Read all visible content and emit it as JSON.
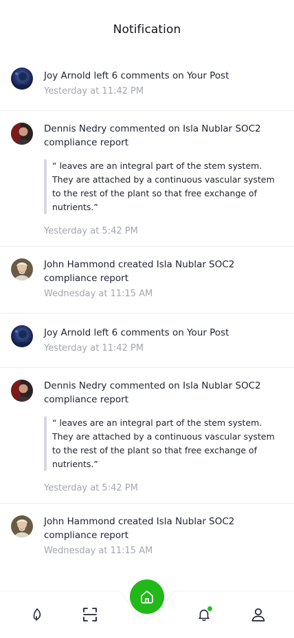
{
  "header": {
    "title": "Notification"
  },
  "notifications": [
    {
      "avatar": "joy-arnold-avatar",
      "title": "Joy Arnold left 6 comments on Your Post",
      "time": "Yesterday at 11:42 PM"
    },
    {
      "avatar": "dennis-nedry-avatar",
      "title": "Dennis Nedry commented on Isla Nublar SOC2 compliance report",
      "quote": "“ leaves are an integral part of the stem system. They are attached by a continuous vascular system to the rest of the plant so that free exchange of nutrients.”",
      "time": "Yesterday at 5:42 PM"
    },
    {
      "avatar": "john-hammond-avatar",
      "title": "John Hammond created Isla Nublar SOC2 compliance report",
      "time": "Wednesday at 11:15 AM"
    },
    {
      "avatar": "joy-arnold-avatar",
      "title": "Joy Arnold left 6 comments on Your Post",
      "time": "Yesterday at 11:42 PM"
    },
    {
      "avatar": "dennis-nedry-avatar",
      "title": "Dennis Nedry commented on Isla Nublar SOC2 compliance report",
      "quote": "“ leaves are an integral part of the stem system. They are attached by a continuous vascular system to the rest of the plant so that free exchange of nutrients.”",
      "time": "Yesterday at 5:42 PM"
    },
    {
      "avatar": "john-hammond-avatar",
      "title": "John Hammond created Isla Nublar SOC2 compliance report",
      "time": "Wednesday at 11:15 AM"
    }
  ],
  "bottom_nav": {
    "items": [
      {
        "icon": "leaf-icon"
      },
      {
        "icon": "scan-icon"
      },
      {
        "icon": "home-icon"
      },
      {
        "icon": "bell-icon"
      },
      {
        "icon": "profile-icon"
      }
    ],
    "colors": {
      "accent": "#21b81a",
      "icon": "#1f2230"
    }
  }
}
